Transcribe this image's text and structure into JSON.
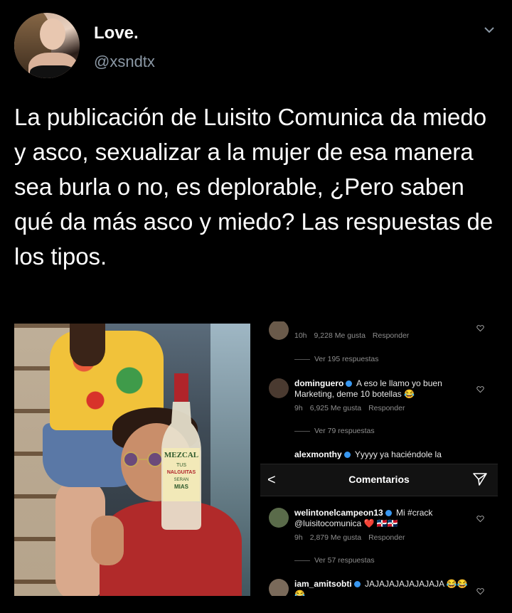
{
  "tweet": {
    "display_name": "Love.",
    "handle": "@xsndtx",
    "text": "La publicación de Luisito Comunica da miedo y asco, sexualizar a la mujer de esa manera sea burla o no, es deplorable, ¿Pero saben qué da más asco y miedo? Las respuestas de los tipos."
  },
  "photo": {
    "bottle_label": "MEZCAL",
    "bottle_text1": "TUS",
    "bottle_text2": "NALGUITAS",
    "bottle_text3": "SERAN",
    "bottle_text4": "MIAS"
  },
  "comments_top": [
    {
      "time": "10h",
      "likes": "9,228 Me gusta",
      "reply": "Responder",
      "more": "Ver 195 respuestas"
    },
    {
      "user": "dominguero",
      "text": "A eso le llamo yo buen Marketing, deme 10 botellas 😂",
      "time": "9h",
      "likes": "6,925 Me gusta",
      "reply": "Responder",
      "more": "Ver 79 respuestas"
    },
    {
      "user": "alexmonthy",
      "text": "Yyyyy ya haciéndole la"
    }
  ],
  "instagram_bar": {
    "title": "Comentarios",
    "back": "<"
  },
  "comments_bottom": [
    {
      "user": "welintonelcampeon13",
      "text": "Mi #crack @luisitocomunica ❤️ 🇩🇴🇩🇴",
      "time": "9h",
      "likes": "2,879 Me gusta",
      "reply": "Responder",
      "more": "Ver 57 respuestas"
    },
    {
      "user": "iam_amitsobti",
      "text": "JAJAJAJAJAJAJAJA 😂😂😂"
    }
  ]
}
